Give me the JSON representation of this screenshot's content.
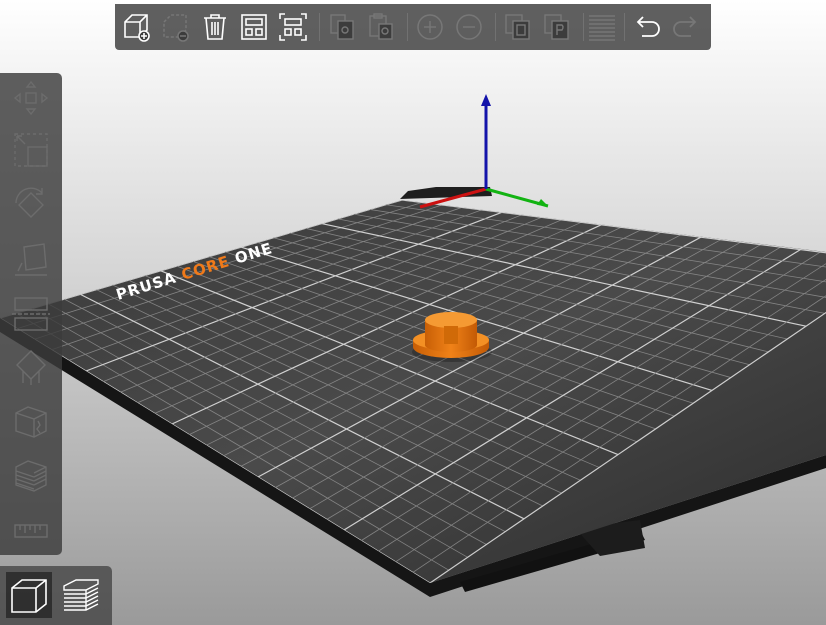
{
  "scene": {
    "printer_brand": {
      "part1": "PRUSA",
      "part2": "CORE",
      "part3": "ONE"
    },
    "brand_accent_color": "#f07a1a",
    "object_color": "#e8760e",
    "bed_color": "#2a2a2a",
    "grid_color": "#8a8a8a",
    "axis_colors": {
      "x": "#cc1111",
      "y": "#12b312",
      "z": "#1313aa"
    }
  },
  "top_toolbar": {
    "buttons": [
      {
        "name": "add-object-icon",
        "enabled": true
      },
      {
        "name": "delete-object-icon",
        "enabled": false
      },
      {
        "name": "delete-all-icon",
        "enabled": true
      },
      {
        "name": "arrange-icon",
        "enabled": true
      },
      {
        "name": "arrange-selection-icon",
        "enabled": true
      },
      {
        "name": "copy-icon",
        "enabled": false
      },
      {
        "name": "paste-icon",
        "enabled": false
      },
      {
        "name": "add-instance-icon",
        "enabled": false
      },
      {
        "name": "remove-instance-icon",
        "enabled": false
      },
      {
        "name": "split-to-objects-icon",
        "enabled": false
      },
      {
        "name": "split-to-parts-icon",
        "enabled": false
      },
      {
        "name": "variable-layer-height-icon",
        "enabled": false
      },
      {
        "name": "undo-icon",
        "enabled": true
      },
      {
        "name": "redo-icon",
        "enabled": false
      }
    ]
  },
  "left_toolbar": {
    "tools": [
      {
        "name": "move-tool-icon"
      },
      {
        "name": "scale-tool-icon"
      },
      {
        "name": "rotate-tool-icon"
      },
      {
        "name": "place-on-face-tool-icon"
      },
      {
        "name": "cut-tool-icon"
      },
      {
        "name": "paint-supports-tool-icon"
      },
      {
        "name": "seam-painting-tool-icon"
      },
      {
        "name": "fuzzy-skin-tool-icon"
      },
      {
        "name": "measure-tool-icon"
      }
    ]
  },
  "view_toggle": {
    "active": "3d-view",
    "items": [
      {
        "name": "3d-view-icon"
      },
      {
        "name": "preview-layers-icon"
      }
    ]
  }
}
